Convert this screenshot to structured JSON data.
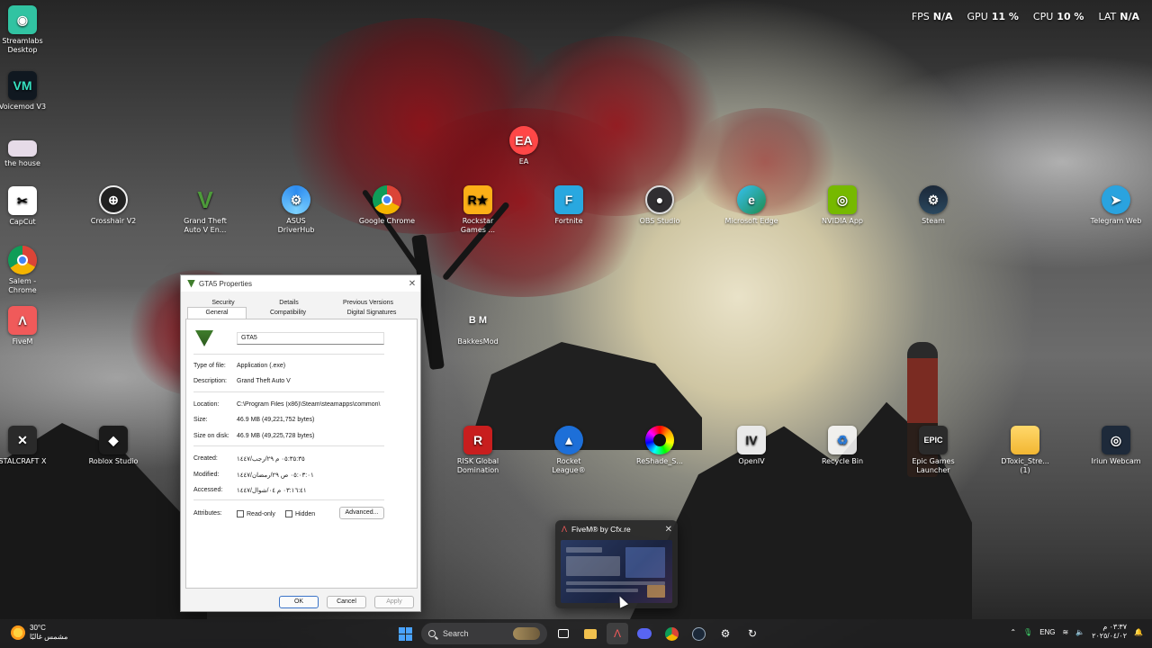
{
  "perf": [
    {
      "label": "FPS",
      "value": "N/A"
    },
    {
      "label": "GPU",
      "value": "11 %"
    },
    {
      "label": "CPU",
      "value": "10 %"
    },
    {
      "label": "LAT",
      "value": "N/A"
    }
  ],
  "desktop_icons": {
    "streamlabs": "Streamlabs Desktop",
    "voicemod": "Voicemod V3",
    "thehouse": "the house",
    "capcut": "CapCut",
    "salem": "Salem - Chrome",
    "fivem": "FiveM",
    "stalcraft": "STALCRAFT X",
    "crosshair": "Crosshair V2",
    "roblox": "Roblox Studio",
    "gta": "Grand Theft Auto V En...",
    "asus": "ASUS DriverHub",
    "chrome": "Google Chrome",
    "rockstar": "Rockstar Games ...",
    "fortnite": "Fortnite",
    "obs": "OBS Studio",
    "edge": "Microsoft Edge",
    "nvidia": "NVIDIA App",
    "steam": "Steam",
    "telegram": "Telegram Web",
    "ea": "EA",
    "bakkes": "BakkesMod",
    "risk": "RISK Global Domination",
    "rocket": "Rocket League®",
    "reshade": "ReShade_S...",
    "openiv": "OpenIV",
    "recycle": "Recycle Bin",
    "epic": "Epic Games Launcher",
    "dtoxic": "DToxic_Stre... (1)",
    "iriun": "Iriun Webcam"
  },
  "dialog": {
    "title": "GTA5 Properties",
    "tabs": {
      "security": "Security",
      "details": "Details",
      "previous": "Previous Versions",
      "general": "General",
      "compat": "Compatibility",
      "digsig": "Digital Signatures"
    },
    "name": "GTA5",
    "type_label": "Type of file:",
    "type_value": "Application (.exe)",
    "desc_label": "Description:",
    "desc_value": "Grand Theft Auto V",
    "loc_label": "Location:",
    "loc_value": "C:\\Program Files (x86)\\Steam\\steamapps\\common\\",
    "size_label": "Size:",
    "size_value": "46.9 MB (49,221,752 bytes)",
    "disk_label": "Size on disk:",
    "disk_value": "46.9 MB (49,225,728 bytes)",
    "created_label": "Created:",
    "created_value": "٠٥:٣٥:٣٥ م ٢٩/رجب/١٤٤٧",
    "modified_label": "Modified:",
    "modified_value": "٠٥:٠٣:٠١ ص ٢٩/رمضان/١٤٤٧",
    "accessed_label": "Accessed:",
    "accessed_value": "٠٣:١٦:٤١ م ٠٤/شوال/١٤٤٧",
    "attr_label": "Attributes:",
    "readonly": "Read-only",
    "hidden": "Hidden",
    "advanced": "Advanced...",
    "ok": "OK",
    "cancel": "Cancel",
    "apply": "Apply"
  },
  "preview": {
    "title": "FiveM® by Cfx.re"
  },
  "taskbar": {
    "temp": "30°C",
    "weather": "مشمس غالبًا",
    "search": "Search",
    "lang": "ENG",
    "time": "٠٣:٣٧ م",
    "date": "٢٠٢٥/٠٤/٠٢"
  },
  "colors": {
    "accent": "#3b74c8",
    "tree_red": "#96101a",
    "taskbar": "#1e1e20"
  }
}
